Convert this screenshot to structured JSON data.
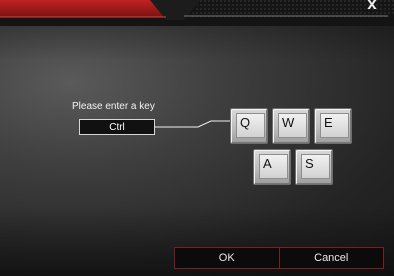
{
  "dialog": {
    "prompt": "Please enter a key",
    "key_value": "Ctrl",
    "close_label": "x"
  },
  "keys": [
    {
      "label": "Q"
    },
    {
      "label": "W"
    },
    {
      "label": "E"
    },
    {
      "label": "A"
    },
    {
      "label": "S"
    }
  ],
  "buttons": {
    "ok": "OK",
    "cancel": "Cancel"
  },
  "colors": {
    "accent": "#a01c1c",
    "background": "#2a2a2a",
    "keycap": "#c9c9c9"
  }
}
